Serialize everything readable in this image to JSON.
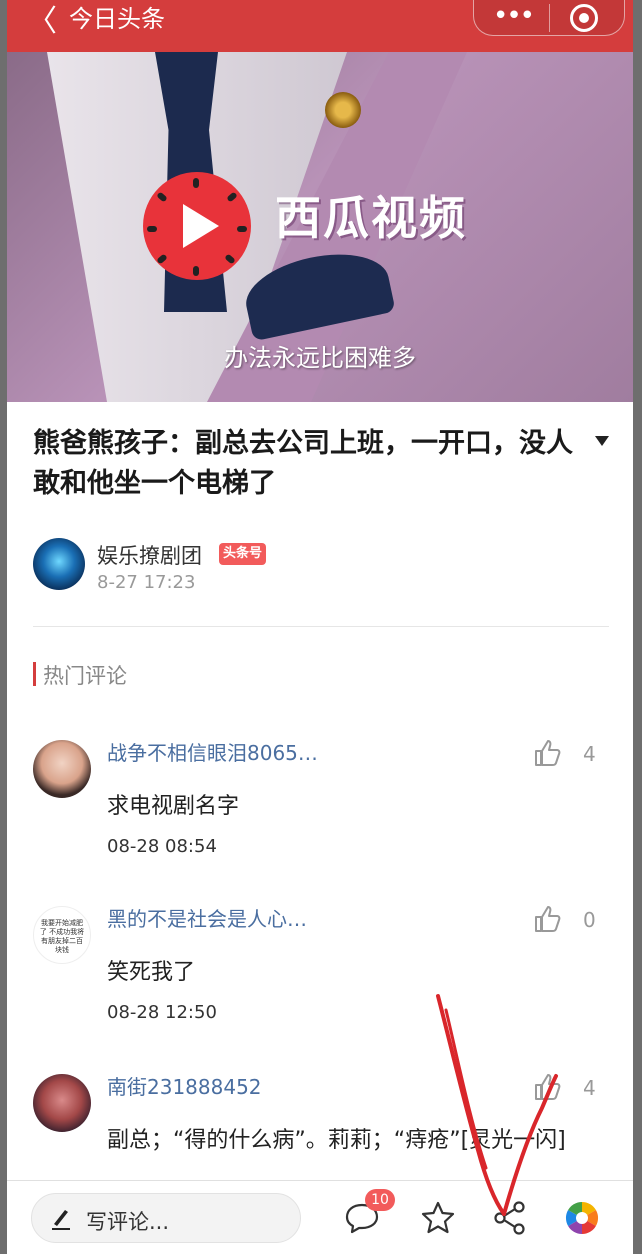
{
  "header": {
    "back_glyph": "〈",
    "title": "今日头条",
    "more_glyph": "•••",
    "background_color": "#d43d3d"
  },
  "video": {
    "brand": "西瓜视频",
    "subtitle": "办法永远比困难多"
  },
  "article": {
    "title": "熊爸熊孩子：副总去公司上班，一开口，没人敢和他坐一个电梯了",
    "author": "娱乐撩剧团",
    "author_badge": "头条号",
    "time": "8-27 17:23"
  },
  "hot_comments_label": "热门评论",
  "comments": [
    {
      "name": "战争不相信眼泪8065…",
      "likes": "4",
      "text": "求电视剧名字",
      "time": "08-28 08:54"
    },
    {
      "name": "黑的不是社会是人心…",
      "likes": "0",
      "text": "笑死我了",
      "time": "08-28 12:50",
      "avatar_text": "我要开始减肥了 不成功我将有朋友掉二百块钱"
    },
    {
      "name": "南街231888452",
      "likes": "4",
      "text": "副总；“得的什么病”。莉莉；“痔疮”[灵光一闪]",
      "time": ""
    }
  ],
  "toolbar": {
    "write_comment": "写评论...",
    "comment_count": "10",
    "icons": [
      "pencil-icon",
      "comment-bubble-icon",
      "star-icon",
      "share-icon",
      "photo-color-wheel-icon"
    ]
  },
  "colors": {
    "accent": "#d43d3d",
    "link_blue": "#4a6ea0",
    "badge_red": "#f25b5b",
    "annotation_red": "#d9262b"
  }
}
